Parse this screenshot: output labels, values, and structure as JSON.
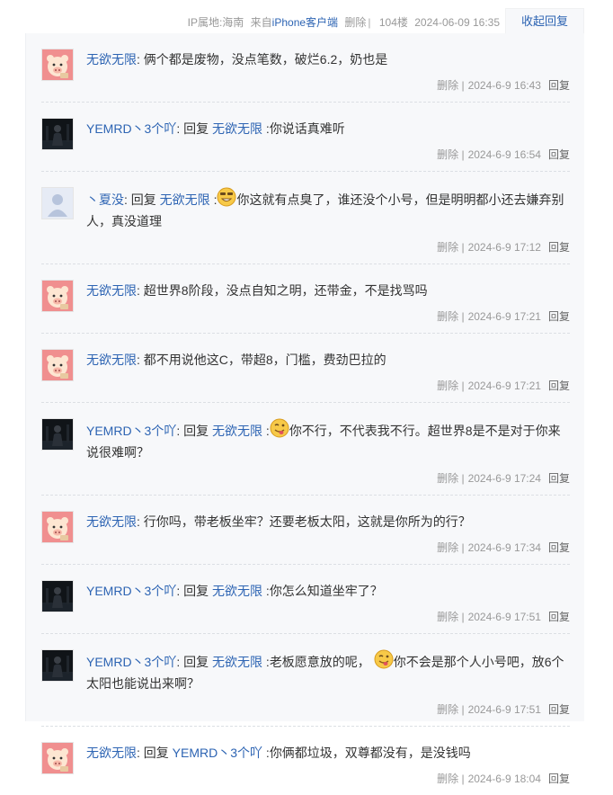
{
  "post_meta": {
    "ip_location": "IP属地:海南",
    "client_prefix": "来自",
    "client_name": "iPhone客户端",
    "delete_label": "删除",
    "floor": "104楼",
    "time": "2024-06-09 16:35",
    "collapse_label": "收起回复"
  },
  "labels": {
    "delete": "删除",
    "sep": "|",
    "reply": "回复",
    "reply_word": "回复",
    "colon": ":"
  },
  "colors": {
    "link": "#2d64b3",
    "panel_bg": "#f7f8fa",
    "meta_text": "#999999"
  },
  "replies": [
    {
      "user": "无欲无限",
      "avatar": "pink-pig-avatar",
      "text": "俩个都是废物，没点笔数，破烂6.2，奶也是",
      "time": "2024-6-9 16:43"
    },
    {
      "user": "YEMRD丶3个吖",
      "avatar": "dark-figure-avatar",
      "reply_to": "无欲无限",
      "text": "你说话真难听",
      "time": "2024-6-9 16:54"
    },
    {
      "user": "丶夏没",
      "avatar": "default-avatar",
      "reply_to": "无欲无限",
      "emoji": "grin-emoji",
      "text": "你这就有点臭了，谁还没个小号，但是明明都小还去嫌弃别人，真没道理",
      "time": "2024-6-9 17:12"
    },
    {
      "user": "无欲无限",
      "avatar": "pink-pig-avatar",
      "text": "超世界8阶段，没点自知之明，还带金，不是找骂吗",
      "time": "2024-6-9 17:21"
    },
    {
      "user": "无欲无限",
      "avatar": "pink-pig-avatar",
      "text": "都不用说他这C，带超8，门槛，费劲巴拉的",
      "time": "2024-6-9 17:21"
    },
    {
      "user": "YEMRD丶3个吖",
      "avatar": "dark-figure-avatar",
      "reply_to": "无欲无限",
      "emoji": "tongue-emoji",
      "text": "你不行，不代表我不行。超世界8是不是对于你来说很难啊？",
      "time": "2024-6-9 17:24"
    },
    {
      "user": "无欲无限",
      "avatar": "pink-pig-avatar",
      "text": "行你吗，带老板坐牢？还要老板太阳，这就是你所为的行？",
      "time": "2024-6-9 17:34"
    },
    {
      "user": "YEMRD丶3个吖",
      "avatar": "dark-figure-avatar",
      "reply_to": "无欲无限",
      "text": "你怎么知道坐牢了？",
      "time": "2024-6-9 17:51"
    },
    {
      "user": "YEMRD丶3个吖",
      "avatar": "dark-figure-avatar",
      "reply_to": "无欲无限",
      "text": "老板愿意放的呢，",
      "emoji_mid": "tongue-emoji",
      "text2": "你不会是那个人小号吧，放6个太阳也能说出来啊？",
      "time": "2024-6-9 17:51"
    },
    {
      "user": "无欲无限",
      "avatar": "pink-pig-avatar",
      "reply_to": "YEMRD丶3个吖",
      "text": "你俩都垃圾，双尊都没有，是没钱吗",
      "time": "2024-6-9 18:04"
    }
  ]
}
